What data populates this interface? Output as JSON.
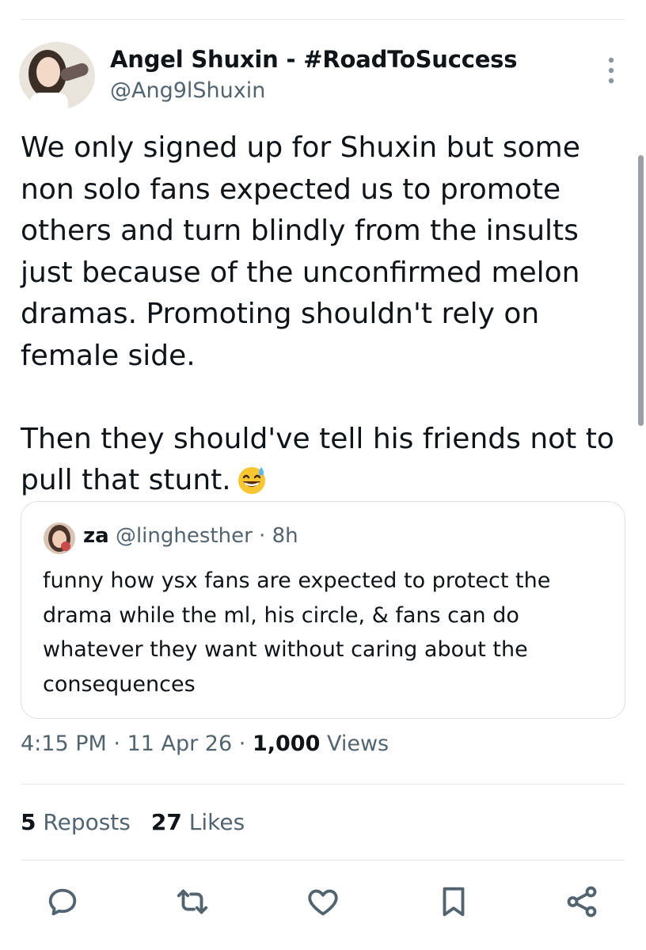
{
  "author": {
    "display_name": "Angel Shuxin - #RoadToSuccess",
    "handle": "@Ang9lShuxin"
  },
  "tweet": {
    "text": "We only signed up for Shuxin but some non solo fans expected us to promote others and turn blindly from the insults just because of the unconfirmed melon dramas. Promoting shouldn't rely on female side.\n\nThen they should've tell his friends not to pull that stunt.",
    "emoji": "grinning-face-with-sweat"
  },
  "quoted_tweet": {
    "name": "za",
    "handle": "@linghesther",
    "separator": "·",
    "age": "8h",
    "text": "funny how ysx fans are expected to protect the drama while the ml, his circle, & fans can do whatever they want without caring about the consequences"
  },
  "meta": {
    "time": "4:15 PM",
    "separator": "·",
    "date": "11 Apr 26",
    "views_count": "1,000",
    "views_label": "Views"
  },
  "stats": {
    "reposts_count": "5",
    "reposts_label": "Reposts",
    "likes_count": "27",
    "likes_label": "Likes"
  },
  "actions": [
    "reply-icon",
    "repost-icon",
    "like-icon",
    "bookmark-icon",
    "share-icon"
  ],
  "colors": {
    "text": "#0f1419",
    "secondary": "#536471",
    "icon": "#536471",
    "border": "#dde1e5"
  }
}
